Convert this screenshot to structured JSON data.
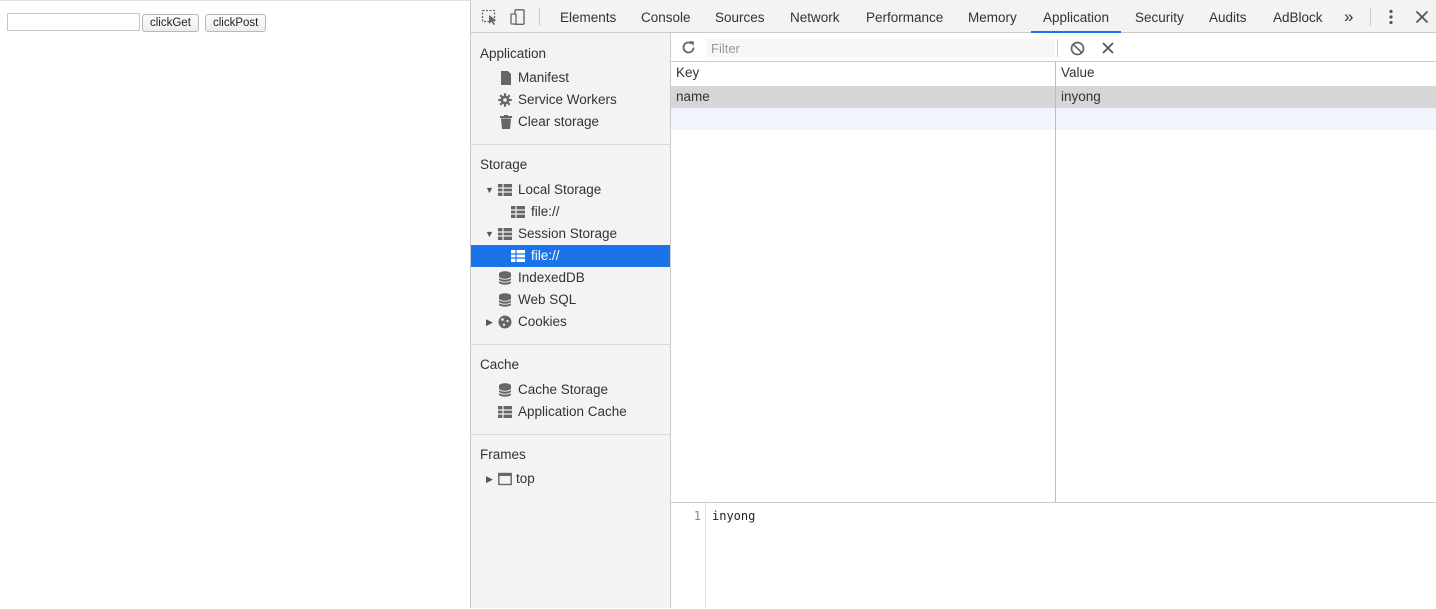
{
  "page": {
    "input_value": "",
    "buttons": [
      {
        "label": "clickGet"
      },
      {
        "label": "clickPost"
      }
    ]
  },
  "devtools": {
    "tabs": [
      {
        "label": "Elements"
      },
      {
        "label": "Console"
      },
      {
        "label": "Sources"
      },
      {
        "label": "Network"
      },
      {
        "label": "Performance"
      },
      {
        "label": "Memory"
      },
      {
        "label": "Application",
        "active": true
      },
      {
        "label": "Security"
      },
      {
        "label": "Audits"
      },
      {
        "label": "AdBlock"
      }
    ],
    "more_tabs_glyph": "»",
    "accent": "#1a73e8",
    "sidebar": {
      "application": {
        "title": "Application",
        "items": [
          {
            "label": "Manifest",
            "icon": "file-icon"
          },
          {
            "label": "Service Workers",
            "icon": "gear-icon"
          },
          {
            "label": "Clear storage",
            "icon": "trash-icon"
          }
        ]
      },
      "storage": {
        "title": "Storage",
        "items": [
          {
            "label": "Local Storage",
            "icon": "table-icon",
            "expanded": true
          },
          {
            "label": "file://",
            "icon": "table-icon"
          },
          {
            "label": "Session Storage",
            "icon": "table-icon",
            "expanded": true
          },
          {
            "label": "file://",
            "icon": "table-icon",
            "selected": true
          },
          {
            "label": "IndexedDB",
            "icon": "database-icon"
          },
          {
            "label": "Web SQL",
            "icon": "database-icon"
          },
          {
            "label": "Cookies",
            "icon": "cookie-icon",
            "expanded": false
          }
        ]
      },
      "cache": {
        "title": "Cache",
        "items": [
          {
            "label": "Cache Storage",
            "icon": "database-icon"
          },
          {
            "label": "Application Cache",
            "icon": "table-icon"
          }
        ]
      },
      "frames": {
        "title": "Frames",
        "items": [
          {
            "label": "top",
            "icon": "frame-icon",
            "expanded": false
          }
        ]
      }
    },
    "toolbar": {
      "filter_placeholder": "Filter"
    },
    "grid": {
      "columns": [
        "Key",
        "Value"
      ],
      "rows": [
        {
          "key": "name",
          "value": "inyong"
        }
      ]
    },
    "preview": {
      "line_number": "1",
      "text": "inyong"
    }
  }
}
